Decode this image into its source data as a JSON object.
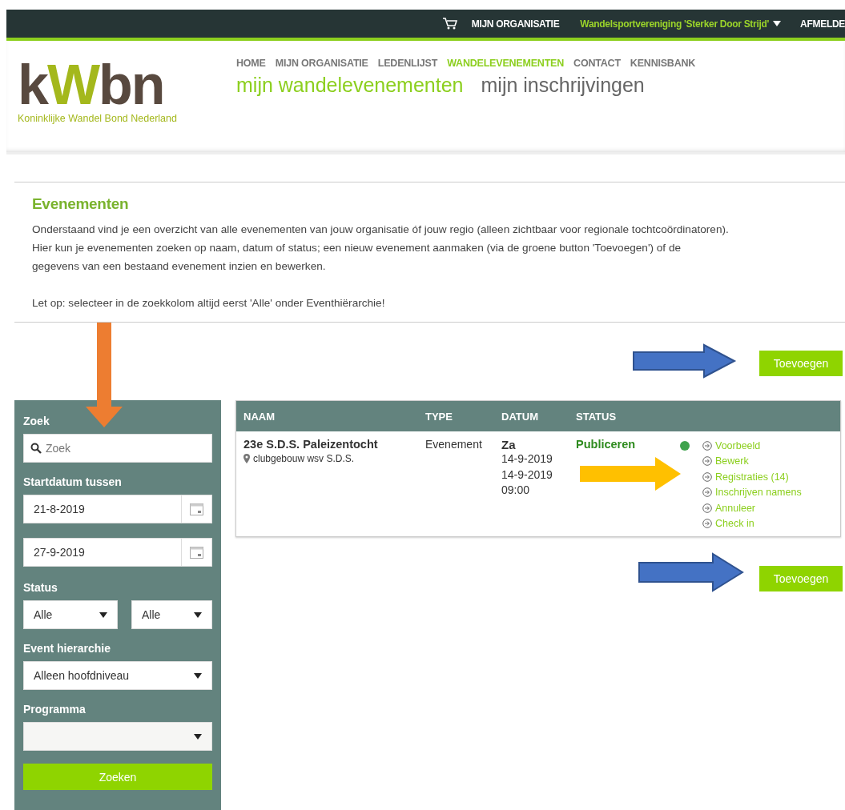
{
  "top_bar": {
    "account": "MIJN ORGANISATIE",
    "organization": "Wandelsportvereniging 'Sterker Door Strijd'",
    "logout": "AFMELDE"
  },
  "logo": {
    "letters": [
      {
        "text": "k",
        "color": "#58493f"
      },
      {
        "text": "W",
        "color": "#a4b81c"
      },
      {
        "text": "bn",
        "color": "#58493f"
      }
    ],
    "tagline": "Koninklijke Wandel Bond Nederland"
  },
  "nav": [
    {
      "label": "HOME",
      "selected": false
    },
    {
      "label": "MIJN ORGANISATIE",
      "selected": false
    },
    {
      "label": "LEDENLIJST",
      "selected": false
    },
    {
      "label": "WANDELEVENEMENTEN",
      "selected": true
    },
    {
      "label": "CONTACT",
      "selected": false
    },
    {
      "label": "KENNISBANK",
      "selected": false
    }
  ],
  "subnav": [
    {
      "label": "mijn wandelevenementen",
      "selected": true
    },
    {
      "label": "mijn inschrijvingen",
      "selected": false
    }
  ],
  "intro": {
    "heading": "Evenementen",
    "paragraphs": [
      "Onderstaand vind je een overzicht van alle evenementen van jouw organisatie óf jouw regio (alleen zichtbaar voor regionale tochtcoördinatoren). Hier kun je evenementen zoeken op naam, datum of status; een nieuw evenement aanmaken (via de groene button 'Toevoegen') of de gegevens van een bestaand evenement inzien en bewerken.",
      "Let op: selecteer in de zoekkolom altijd eerst 'Alle' onder Eventhiërarchie!"
    ]
  },
  "add_buttons": [
    "Toevoegen",
    "Toevoegen"
  ],
  "filters": {
    "search": {
      "label": "Zoek",
      "placeholder": "Zoek"
    },
    "start_date": {
      "label": "Startdatum tussen",
      "from": "21-8-2019",
      "to": "27-9-2019"
    },
    "status": {
      "label": "Status",
      "selects": [
        "Alle",
        "Alle"
      ]
    },
    "hierarchy": {
      "label": "Event hierarchie",
      "value": "Alleen hoofdniveau"
    },
    "program": {
      "label": "Programma"
    },
    "submit": "Zoeken"
  },
  "table": {
    "columns": [
      "NAAM",
      "TYPE",
      "DATUM",
      "STATUS"
    ],
    "rows": [
      {
        "name": "23e S.D.S. Paleizentocht",
        "location": "clubgebouw wsv S.D.S.",
        "type": "Evenement",
        "day": "Za",
        "dates": [
          "14-9-2019",
          "14-9-2019",
          "09:00"
        ],
        "status": "Publiceren",
        "color": "#3fa34d",
        "actions": [
          "Voorbeeld",
          "Bewerk",
          "Registraties (14)",
          "Inschrijven namens",
          "Annuleer",
          "Check in"
        ]
      }
    ]
  }
}
